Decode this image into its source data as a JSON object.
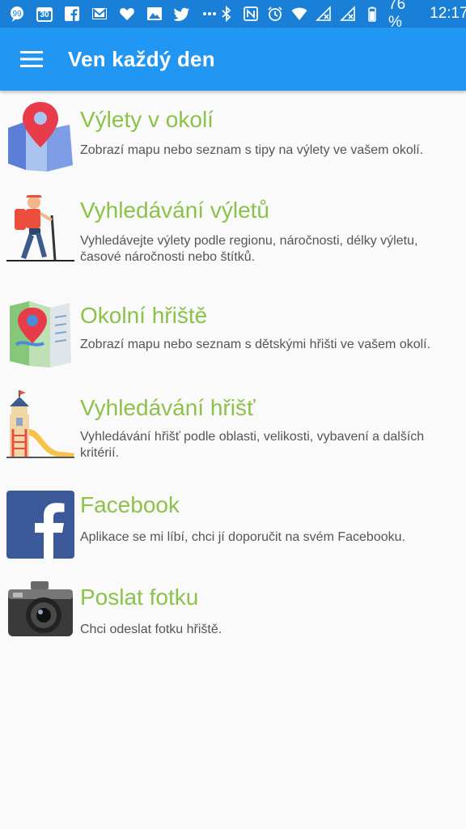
{
  "status_bar": {
    "calendar_day": "30",
    "battery_text": "76 %",
    "time": "12:17"
  },
  "app_bar": {
    "title": "Ven každý den"
  },
  "menu": [
    {
      "title": "Výlety v okolí",
      "description": "Zobrazí mapu nebo seznam s tipy na výlety ve vašem okolí.",
      "icon": "map-pin-icon"
    },
    {
      "title": "Vyhledávání výletů",
      "description": "Vyhledávejte výlety podle regionu, náročnosti, délky výletu, časové náročnosti nebo štítků.",
      "icon": "hiker-icon"
    },
    {
      "title": "Okolní hřiště",
      "description": "Zobrazí mapu nebo seznam s dětskými hřišti ve vašem okolí.",
      "icon": "folded-map-icon"
    },
    {
      "title": "Vyhledávání hřišť",
      "description": "Vyhledávání hřišť podle oblasti, velikosti, vybavení a dalších kritérií.",
      "icon": "playground-slide-icon"
    },
    {
      "title": "Facebook",
      "description": "Aplikace se mi líbí, chci jí doporučit na svém Facebooku.",
      "icon": "facebook-icon"
    },
    {
      "title": "Poslat fotku",
      "description": "Chci odeslat fotku hřiště.",
      "icon": "camera-icon"
    }
  ],
  "colors": {
    "status_bar": "#1a7fd6",
    "app_bar": "#2196f3",
    "title_green": "#8bc34a",
    "background": "#fafafa"
  }
}
